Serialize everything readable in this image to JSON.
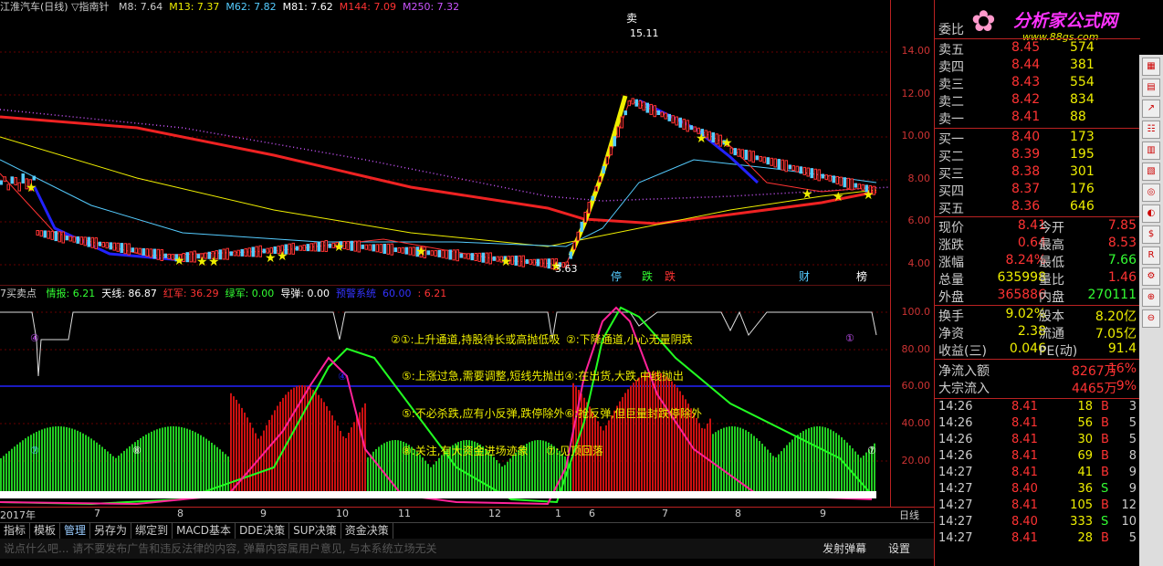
{
  "header": {
    "title": "江淮汽车(日线) ▽指南针",
    "ma": [
      {
        "label": "M8: 7.64",
        "color": "#ccc"
      },
      {
        "label": "M13: 7.37",
        "color": "#ee0"
      },
      {
        "label": "M62: 7.82",
        "color": "#5cf"
      },
      {
        "label": "M81: 7.62",
        "color": "#fff"
      },
      {
        "label": "M144: 7.09",
        "color": "#f33"
      },
      {
        "label": "M250: 7.32",
        "color": "#c5f"
      }
    ]
  },
  "price_axis": [
    "14.00",
    "12.00",
    "10.00",
    "8.00",
    "6.00",
    "4.00"
  ],
  "ind_axis": [
    "100.0",
    "80.00",
    "60.00",
    "40.00",
    "20.00"
  ],
  "annotations": {
    "sell_top": "卖",
    "peak": "15.11",
    "low": "3.63",
    "marks": [
      "停",
      "跌",
      "跌",
      "财",
      "榜"
    ]
  },
  "ind_header": {
    "name": "7买卖点",
    "items": [
      {
        "label": "情报: 6.21",
        "color": "#3f3"
      },
      {
        "label": "天线: 86.87",
        "color": "#fff"
      },
      {
        "label": "红军: 36.29",
        "color": "#f33"
      },
      {
        "label": "绿军: 0.00",
        "color": "#3f3"
      },
      {
        "label": "导弹: 0.00",
        "color": "#fff"
      },
      {
        "label": "预警系统",
        "color": "#33f"
      },
      {
        "label": "60.00",
        "color": "#33f"
      },
      {
        "label": ": 6.21",
        "color": "#f33"
      }
    ]
  },
  "legend_text": [
    "②①:上升通道,持股待长或高抛低吸",
    "②:下降通道,小心无量阴跌",
    "⑤:上涨过急,需要调整,短线先抛出④:在出货,大跌,中线抛出",
    "⑤:不必杀跌,应有小反弹,跌停除外⑥:抢反弹,但巨量封跌停除外",
    "⑧:关注,有大资金进场迹象",
    "⑦:见顶回落"
  ],
  "x_ticks": [
    "2017年",
    "7",
    "8",
    "9",
    "10",
    "11",
    "12",
    "1",
    "6",
    "7",
    "8",
    "9"
  ],
  "period": "日线",
  "tabs": [
    "指标",
    "模板",
    "管理",
    "另存为",
    "绑定到",
    "MACD基本",
    "DDE决策",
    "SUP决策",
    "资金决策"
  ],
  "chat": {
    "placeholder": "说点什么吧... 请不要发布广告和违反法律的内容, 弹幕内容属用户意见, 与本系统立场无关",
    "send": "发射弹幕",
    "settings": "设置"
  },
  "logo": {
    "text": "分析家公式网",
    "url": "www.88gs.com"
  },
  "orderbook": {
    "wei": "委比",
    "sells": [
      {
        "l": "卖五",
        "p": "8.45",
        "v": "574"
      },
      {
        "l": "卖四",
        "p": "8.44",
        "v": "381"
      },
      {
        "l": "卖三",
        "p": "8.43",
        "v": "554"
      },
      {
        "l": "卖二",
        "p": "8.42",
        "v": "834"
      },
      {
        "l": "卖一",
        "p": "8.41",
        "v": "88"
      }
    ],
    "buys": [
      {
        "l": "买一",
        "p": "8.40",
        "v": "173"
      },
      {
        "l": "买二",
        "p": "8.39",
        "v": "195"
      },
      {
        "l": "买三",
        "p": "8.38",
        "v": "301"
      },
      {
        "l": "买四",
        "p": "8.37",
        "v": "176"
      },
      {
        "l": "买五",
        "p": "8.36",
        "v": "646"
      }
    ]
  },
  "quote": [
    {
      "k": "现价",
      "a": "8.41",
      "k2": "今开",
      "b": "7.85",
      "ac": "#f33",
      "bc": "#f33"
    },
    {
      "k": "涨跌",
      "a": "0.64",
      "k2": "最高",
      "b": "8.53",
      "ac": "#f33",
      "bc": "#f33"
    },
    {
      "k": "涨幅",
      "a": "8.24%",
      "k2": "最低",
      "b": "7.66",
      "ac": "#f33",
      "bc": "#3f3"
    },
    {
      "k": "总量",
      "a": "635998",
      "k2": "量比",
      "b": "1.46",
      "ac": "#ee0",
      "bc": "#f33"
    },
    {
      "k": "外盘",
      "a": "365886",
      "k2": "内盘",
      "b": "270111",
      "ac": "#f33",
      "bc": "#3f3"
    },
    {
      "k": "换手",
      "a": "9.02%",
      "k2": "股本",
      "b": "8.20亿",
      "ac": "#ee0",
      "bc": "#ee0"
    },
    {
      "k": "净资",
      "a": "2.38",
      "k2": "流通",
      "b": "7.05亿",
      "ac": "#ee0",
      "bc": "#ee0"
    },
    {
      "k": "收益(三)",
      "a": "0.046",
      "k2": "PE(动)",
      "b": "91.4",
      "ac": "#ee0",
      "bc": "#ee0"
    }
  ],
  "flows": [
    {
      "k": "净流入额",
      "a": "8267万",
      "b": "16%"
    },
    {
      "k": "大宗流入",
      "a": "4465万",
      "b": "9%"
    }
  ],
  "ticks": [
    {
      "t": "14:26",
      "p": "8.41",
      "v": "18",
      "s": "B",
      "n": "3"
    },
    {
      "t": "14:26",
      "p": "8.41",
      "v": "56",
      "s": "B",
      "n": "5"
    },
    {
      "t": "14:26",
      "p": "8.41",
      "v": "30",
      "s": "B",
      "n": "5"
    },
    {
      "t": "14:26",
      "p": "8.41",
      "v": "69",
      "s": "B",
      "n": "8"
    },
    {
      "t": "14:27",
      "p": "8.41",
      "v": "41",
      "s": "B",
      "n": "9"
    },
    {
      "t": "14:27",
      "p": "8.40",
      "v": "36",
      "s": "S",
      "n": "9"
    },
    {
      "t": "14:27",
      "p": "8.41",
      "v": "105",
      "s": "B",
      "n": "12"
    },
    {
      "t": "14:27",
      "p": "8.40",
      "v": "333",
      "s": "S",
      "n": "10"
    },
    {
      "t": "14:27",
      "p": "8.41",
      "v": "28",
      "s": "B",
      "n": "5"
    }
  ]
}
